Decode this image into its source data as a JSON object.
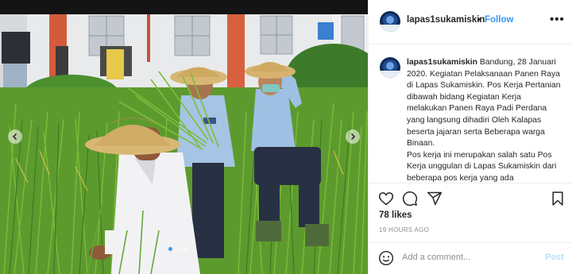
{
  "post": {
    "username": "lapas1sukamiskin",
    "follow_label": "Follow",
    "separator": "•",
    "more_label": "•••",
    "caption_paragraphs": [
      "Bandung, 28 Januari 2020. Kegiatan Pelaksanaan Panen Raya di Lapas Sukamiskin. Pos Kerja Pertanian dibawah bidang Kegiatan Kerja melakukan Panen Raya Padi Perdana yang langsung dihadiri Oleh Kalapas beserta jajaran serta Beberapa warga Binaan.",
      "Pos kerja ini merupakan salah satu Pos Kerja unggulan di Lapas Sukamiskin dari beberapa pos kerja yang ada"
    ],
    "likes": "78 likes",
    "time_ago": "19 HOURS AGO",
    "comment_placeholder": "Add a comment...",
    "post_button": "Post"
  },
  "carousel": {
    "slide_count": 3,
    "active_index": 0
  },
  "icons": {
    "like": "heart-icon",
    "comment": "comment-icon",
    "share": "share-icon",
    "save": "bookmark-icon",
    "emoji": "emoji-icon",
    "prev": "chevron-left-icon",
    "next": "chevron-right-icon"
  },
  "colors": {
    "link": "#3897f0",
    "post_disabled": "#b2dffc",
    "muted": "#8e8e8e"
  }
}
